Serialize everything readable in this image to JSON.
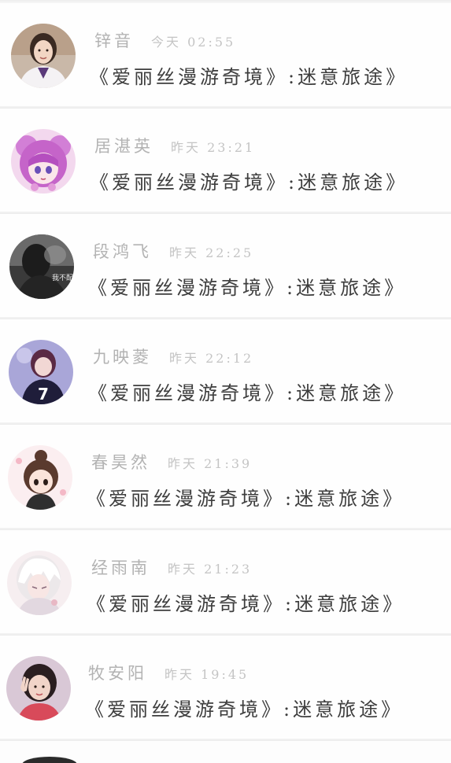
{
  "comments": [
    {
      "name": "锌音",
      "time": "今天 02:55",
      "message": "《爱丽丝漫游奇境》:迷意旅途》",
      "avatar": "avatar-woman-white-coat"
    },
    {
      "name": "居湛英",
      "time": "昨天 23:21",
      "message": "《爱丽丝漫游奇境》:迷意旅途》",
      "avatar": "avatar-anime-pink-hair"
    },
    {
      "name": "段鸿飞",
      "time": "昨天 22:25",
      "message": "《爱丽丝漫游奇境》:迷意旅途》",
      "avatar": "avatar-dark-photo"
    },
    {
      "name": "九映菱",
      "time": "昨天 22:12",
      "message": "《爱丽丝漫游奇境》:迷意旅途》",
      "avatar": "avatar-anime-jersey-7"
    },
    {
      "name": "春昊然",
      "time": "昨天 21:39",
      "message": "《爱丽丝漫游奇境》:迷意旅途》",
      "avatar": "avatar-chibi-girl"
    },
    {
      "name": "经雨南",
      "time": "昨天 21:23",
      "message": "《爱丽丝漫游奇境》:迷意旅途》",
      "avatar": "avatar-anime-white-hair"
    },
    {
      "name": "牧安阳",
      "time": "昨天 19:45",
      "message": "《爱丽丝漫游奇境》:迷意旅途》",
      "avatar": "avatar-girl-peace-sign"
    }
  ],
  "jersey_number": "7",
  "avatar_overlay_text": "我不配"
}
